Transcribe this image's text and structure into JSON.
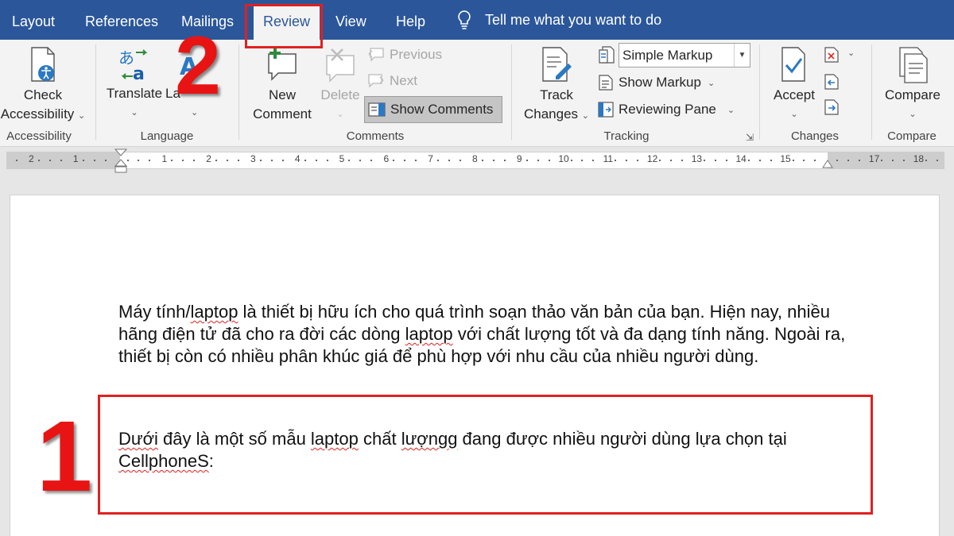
{
  "tabs": {
    "layout": "Layout",
    "references": "References",
    "mailings": "Mailings",
    "review": "Review",
    "view": "View",
    "help": "Help",
    "tell_me": "Tell me what you want to do"
  },
  "ribbon": {
    "accessibility": {
      "check_line1": "Check",
      "check_line2": "Accessibility",
      "group": "Accessibility"
    },
    "language": {
      "translate": "Translate",
      "language_partial": "La",
      "group": "Language"
    },
    "comments": {
      "new_line1": "New",
      "new_line2": "Comment",
      "delete": "Delete",
      "previous": "Previous",
      "next": "Next",
      "show_comments": "Show Comments",
      "group": "Comments"
    },
    "tracking": {
      "track_line1": "Track",
      "track_line2": "Changes",
      "markup_value": "Simple Markup",
      "show_markup": "Show Markup",
      "reviewing_pane": "Reviewing Pane",
      "group": "Tracking"
    },
    "changes": {
      "accept": "Accept",
      "group": "Changes"
    },
    "compare": {
      "compare": "Compare",
      "group": "Compare"
    }
  },
  "ruler": {
    "left_labels": [
      "2",
      "1"
    ],
    "labels": [
      "1",
      "2",
      "3",
      "4",
      "5",
      "6",
      "7",
      "8",
      "9",
      "10",
      "11",
      "12",
      "13",
      "14",
      "15"
    ],
    "right_labels": [
      "17",
      "18"
    ]
  },
  "document": {
    "p1_a": "Máy tính/",
    "p1_laptop1": "laptop",
    "p1_b": " là thiết bị hữu ích cho quá trình soạn thảo văn bản của bạn. Hiện nay, nhiều hãng điện tử đã cho ra đời các dòng ",
    "p1_laptop2": "laptop",
    "p1_c": " với chất lượng tốt và đa dạng tính năng. Ngoài ra, thiết bị còn có nhiều phân khúc giá để phù hợp với nhu cầu của nhiều người dùng.",
    "p2_a": "Dưới",
    "p2_b": " đây là một số mẫu ",
    "p2_laptop": "laptop",
    "p2_c": " chất ",
    "p2_luongg": "lượngg",
    "p2_d": " đang được nhiều người dùng lựa chọn tại ",
    "p2_cellphones": "CellphoneS",
    "p2_e": ":"
  },
  "annotations": {
    "step1": "1",
    "step2": "2",
    "highlight_color": "#e02020"
  },
  "colors": {
    "title_bar": "#2b579a",
    "ribbon": "#f3f3f3"
  }
}
